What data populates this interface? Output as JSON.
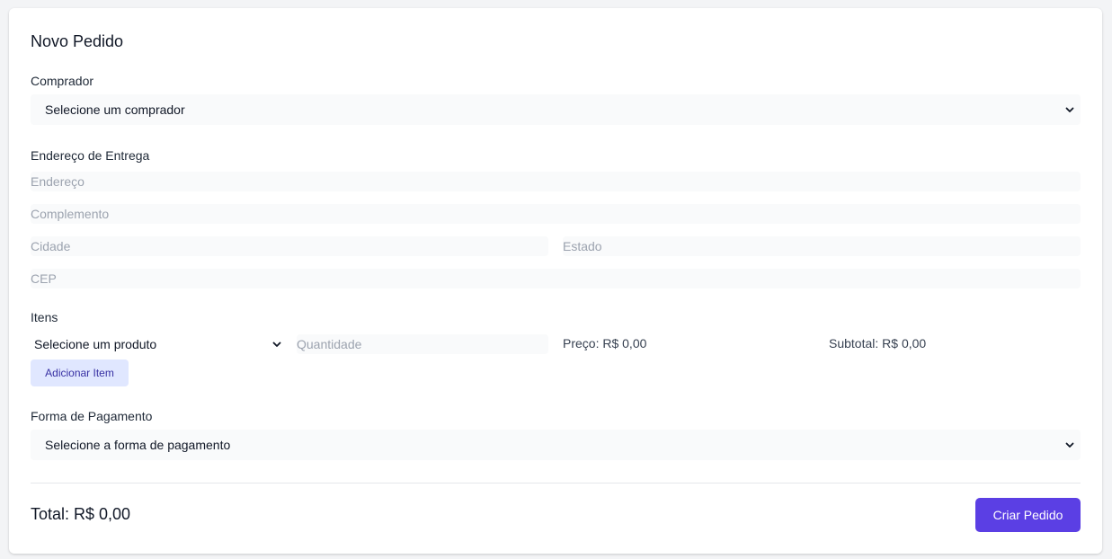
{
  "form": {
    "title": "Novo Pedido",
    "buyer": {
      "label": "Comprador",
      "selected": "Selecione um comprador"
    },
    "address": {
      "label": "Endereço de Entrega",
      "street_placeholder": "Endereço",
      "complement_placeholder": "Complemento",
      "city_placeholder": "Cidade",
      "state_placeholder": "Estado",
      "zip_placeholder": "CEP"
    },
    "items": {
      "label": "Itens",
      "product_selected": "Selecione um produto",
      "quantity_placeholder": "Quantidade",
      "price_text": "Preço: R$ 0,00",
      "subtotal_text": "Subtotal: R$ 0,00",
      "add_button": "Adicionar Item"
    },
    "payment": {
      "label": "Forma de Pagamento",
      "selected": "Selecione a forma de pagamento"
    },
    "total_text": "Total: R$ 0,00",
    "submit_button": "Criar Pedido"
  },
  "icons": {
    "dropdown": "chevron-down-icon"
  },
  "colors": {
    "accent": "#5b3fe4",
    "add_button_bg": "#e0e7ff",
    "add_button_text": "#3730a3",
    "field_bg": "#f9fafb",
    "placeholder": "#9ca3af"
  }
}
